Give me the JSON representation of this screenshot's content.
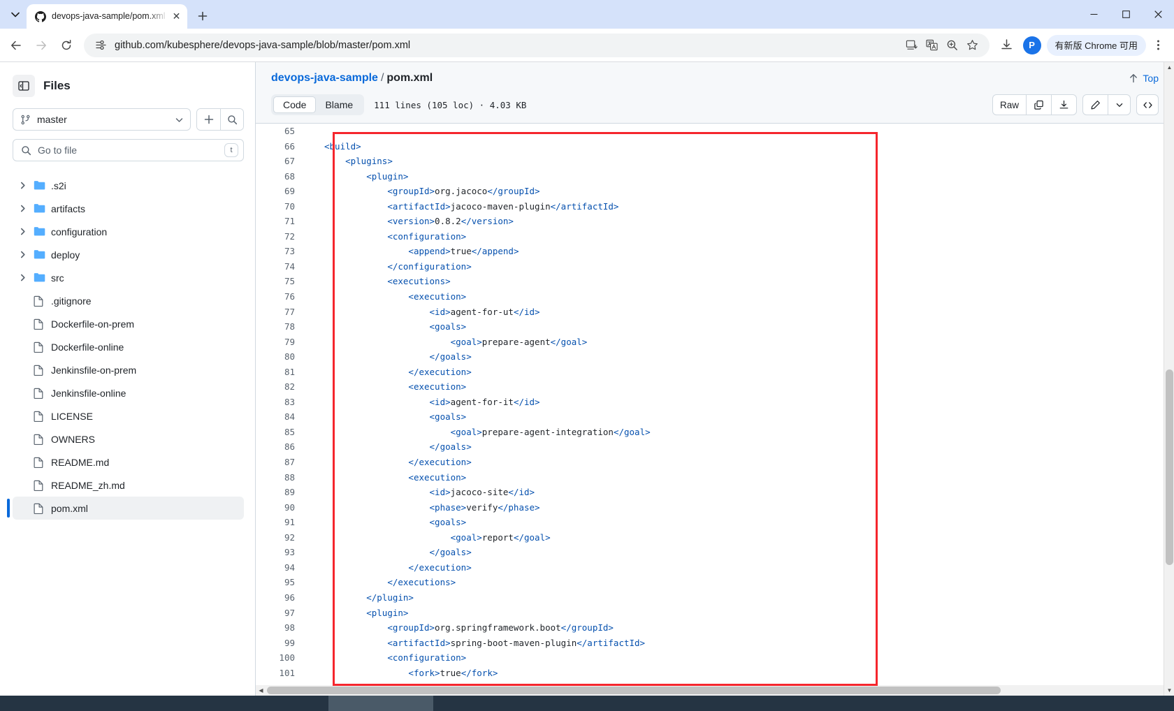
{
  "browser": {
    "tab": {
      "title": "devops-java-sample/pom.xml",
      "favicon_name": "github-icon",
      "close_label": "✕"
    },
    "newtab_label": "+",
    "window_controls": {
      "minimize": "–",
      "maximize": "❐",
      "close": "✕"
    },
    "nav": {
      "back": "←",
      "forward": "→",
      "reload": "⟳"
    },
    "omnibox": {
      "url": "github.com/kubesphere/devops-java-sample/blob/master/pom.xml",
      "site_info_icon": "site-settings-icon",
      "actions": [
        "install-app-icon",
        "translate-icon",
        "zoom-icon",
        "bookmark-star-icon"
      ]
    },
    "downloads_icon": "download-icon",
    "profile_initial": "P",
    "update_button": "有新版 Chrome 可用",
    "menu_icon": "three-dots-vertical-icon"
  },
  "sidebar": {
    "title": "Files",
    "panel_toggle_icon": "collapse-panel-icon",
    "branch": {
      "name": "master",
      "icon": "git-branch-icon",
      "caret": "▾"
    },
    "add_button_icon": "plus-icon",
    "search_button_icon": "search-icon",
    "gotofile": {
      "placeholder": "Go to file",
      "icon": "search-icon",
      "shortcut": "t"
    },
    "tree": [
      {
        "type": "folder",
        "label": ".s2i",
        "expanded": false
      },
      {
        "type": "folder",
        "label": "artifacts",
        "expanded": false
      },
      {
        "type": "folder",
        "label": "configuration",
        "expanded": false
      },
      {
        "type": "folder",
        "label": "deploy",
        "expanded": false
      },
      {
        "type": "folder",
        "label": "src",
        "expanded": false
      },
      {
        "type": "file",
        "label": ".gitignore"
      },
      {
        "type": "file",
        "label": "Dockerfile-on-prem"
      },
      {
        "type": "file",
        "label": "Dockerfile-online"
      },
      {
        "type": "file",
        "label": "Jenkinsfile-on-prem"
      },
      {
        "type": "file",
        "label": "Jenkinsfile-online"
      },
      {
        "type": "file",
        "label": "LICENSE"
      },
      {
        "type": "file",
        "label": "OWNERS"
      },
      {
        "type": "file",
        "label": "README.md"
      },
      {
        "type": "file",
        "label": "README_zh.md"
      },
      {
        "type": "file",
        "label": "pom.xml",
        "selected": true
      }
    ]
  },
  "file_view": {
    "breadcrumb": {
      "repo": "devops-java-sample",
      "separator": "/",
      "file": "pom.xml"
    },
    "top_link": {
      "label": "Top",
      "icon": "arrow-up-icon"
    },
    "tabs": [
      {
        "label": "Code",
        "active": true
      },
      {
        "label": "Blame",
        "active": false
      }
    ],
    "meta": "111 lines (105 loc) · 4.03 KB",
    "actions": {
      "raw": "Raw",
      "copy_icon": "copy-icon",
      "download_icon": "download-icon",
      "edit_icon": "pencil-icon",
      "edit_caret": "▾",
      "symbols_icon": "code-brackets-icon"
    },
    "scroll": {
      "vertical_icon": "scrollbar-thumb",
      "horizontal_icon": "scrollbar-thumb"
    }
  },
  "code": {
    "language": "xml",
    "first_visible_line": 65,
    "lines": [
      {
        "n": 65,
        "tokens": []
      },
      {
        "n": 66,
        "tokens": [
          {
            "t": "tag",
            "v": "<build>"
          }
        ],
        "indent": 0
      },
      {
        "n": 67,
        "tokens": [
          {
            "t": "tag",
            "v": "<plugins>"
          }
        ],
        "indent": 1
      },
      {
        "n": 68,
        "tokens": [
          {
            "t": "tag",
            "v": "<plugin>"
          }
        ],
        "indent": 2
      },
      {
        "n": 69,
        "tokens": [
          {
            "t": "tag",
            "v": "<groupId>"
          },
          {
            "t": "txt",
            "v": "org.jacoco"
          },
          {
            "t": "tag",
            "v": "</groupId>"
          }
        ],
        "indent": 3
      },
      {
        "n": 70,
        "tokens": [
          {
            "t": "tag",
            "v": "<artifactId>"
          },
          {
            "t": "txt",
            "v": "jacoco-maven-plugin"
          },
          {
            "t": "tag",
            "v": "</artifactId>"
          }
        ],
        "indent": 3
      },
      {
        "n": 71,
        "tokens": [
          {
            "t": "tag",
            "v": "<version>"
          },
          {
            "t": "txt",
            "v": "0.8.2"
          },
          {
            "t": "tag",
            "v": "</version>"
          }
        ],
        "indent": 3
      },
      {
        "n": 72,
        "tokens": [
          {
            "t": "tag",
            "v": "<configuration>"
          }
        ],
        "indent": 3
      },
      {
        "n": 73,
        "tokens": [
          {
            "t": "tag",
            "v": "<append>"
          },
          {
            "t": "txt",
            "v": "true"
          },
          {
            "t": "tag",
            "v": "</append>"
          }
        ],
        "indent": 4
      },
      {
        "n": 74,
        "tokens": [
          {
            "t": "tag",
            "v": "</configuration>"
          }
        ],
        "indent": 3
      },
      {
        "n": 75,
        "tokens": [
          {
            "t": "tag",
            "v": "<executions>"
          }
        ],
        "indent": 3
      },
      {
        "n": 76,
        "tokens": [
          {
            "t": "tag",
            "v": "<execution>"
          }
        ],
        "indent": 4
      },
      {
        "n": 77,
        "tokens": [
          {
            "t": "tag",
            "v": "<id>"
          },
          {
            "t": "txt",
            "v": "agent-for-ut"
          },
          {
            "t": "tag",
            "v": "</id>"
          }
        ],
        "indent": 5
      },
      {
        "n": 78,
        "tokens": [
          {
            "t": "tag",
            "v": "<goals>"
          }
        ],
        "indent": 5
      },
      {
        "n": 79,
        "tokens": [
          {
            "t": "tag",
            "v": "<goal>"
          },
          {
            "t": "txt",
            "v": "prepare-agent"
          },
          {
            "t": "tag",
            "v": "</goal>"
          }
        ],
        "indent": 6
      },
      {
        "n": 80,
        "tokens": [
          {
            "t": "tag",
            "v": "</goals>"
          }
        ],
        "indent": 5
      },
      {
        "n": 81,
        "tokens": [
          {
            "t": "tag",
            "v": "</execution>"
          }
        ],
        "indent": 4
      },
      {
        "n": 82,
        "tokens": [
          {
            "t": "tag",
            "v": "<execution>"
          }
        ],
        "indent": 4
      },
      {
        "n": 83,
        "tokens": [
          {
            "t": "tag",
            "v": "<id>"
          },
          {
            "t": "txt",
            "v": "agent-for-it"
          },
          {
            "t": "tag",
            "v": "</id>"
          }
        ],
        "indent": 5
      },
      {
        "n": 84,
        "tokens": [
          {
            "t": "tag",
            "v": "<goals>"
          }
        ],
        "indent": 5
      },
      {
        "n": 85,
        "tokens": [
          {
            "t": "tag",
            "v": "<goal>"
          },
          {
            "t": "txt",
            "v": "prepare-agent-integration"
          },
          {
            "t": "tag",
            "v": "</goal>"
          }
        ],
        "indent": 6
      },
      {
        "n": 86,
        "tokens": [
          {
            "t": "tag",
            "v": "</goals>"
          }
        ],
        "indent": 5
      },
      {
        "n": 87,
        "tokens": [
          {
            "t": "tag",
            "v": "</execution>"
          }
        ],
        "indent": 4
      },
      {
        "n": 88,
        "tokens": [
          {
            "t": "tag",
            "v": "<execution>"
          }
        ],
        "indent": 4
      },
      {
        "n": 89,
        "tokens": [
          {
            "t": "tag",
            "v": "<id>"
          },
          {
            "t": "txt",
            "v": "jacoco-site"
          },
          {
            "t": "tag",
            "v": "</id>"
          }
        ],
        "indent": 5
      },
      {
        "n": 90,
        "tokens": [
          {
            "t": "tag",
            "v": "<phase>"
          },
          {
            "t": "txt",
            "v": "verify"
          },
          {
            "t": "tag",
            "v": "</phase>"
          }
        ],
        "indent": 5
      },
      {
        "n": 91,
        "tokens": [
          {
            "t": "tag",
            "v": "<goals>"
          }
        ],
        "indent": 5
      },
      {
        "n": 92,
        "tokens": [
          {
            "t": "tag",
            "v": "<goal>"
          },
          {
            "t": "txt",
            "v": "report"
          },
          {
            "t": "tag",
            "v": "</goal>"
          }
        ],
        "indent": 6
      },
      {
        "n": 93,
        "tokens": [
          {
            "t": "tag",
            "v": "</goals>"
          }
        ],
        "indent": 5
      },
      {
        "n": 94,
        "tokens": [
          {
            "t": "tag",
            "v": "</execution>"
          }
        ],
        "indent": 4
      },
      {
        "n": 95,
        "tokens": [
          {
            "t": "tag",
            "v": "</executions>"
          }
        ],
        "indent": 3
      },
      {
        "n": 96,
        "tokens": [
          {
            "t": "tag",
            "v": "</plugin>"
          }
        ],
        "indent": 2
      },
      {
        "n": 97,
        "tokens": [
          {
            "t": "tag",
            "v": "<plugin>"
          }
        ],
        "indent": 2
      },
      {
        "n": 98,
        "tokens": [
          {
            "t": "tag",
            "v": "<groupId>"
          },
          {
            "t": "txt",
            "v": "org.springframework.boot"
          },
          {
            "t": "tag",
            "v": "</groupId>"
          }
        ],
        "indent": 3
      },
      {
        "n": 99,
        "tokens": [
          {
            "t": "tag",
            "v": "<artifactId>"
          },
          {
            "t": "txt",
            "v": "spring-boot-maven-plugin"
          },
          {
            "t": "tag",
            "v": "</artifactId>"
          }
        ],
        "indent": 3
      },
      {
        "n": 100,
        "tokens": [
          {
            "t": "tag",
            "v": "<configuration>"
          }
        ],
        "indent": 3
      },
      {
        "n": 101,
        "tokens": [
          {
            "t": "tag",
            "v": "<fork>"
          },
          {
            "t": "txt",
            "v": "true"
          },
          {
            "t": "tag",
            "v": "</fork>"
          }
        ],
        "indent": 4
      }
    ]
  },
  "annotation": {
    "color": "#f5262d",
    "shape": "rectangle"
  },
  "colors": {
    "accent_link": "#0969da",
    "xml_tag": "#0550ae",
    "text": "#1f2328",
    "muted": "#59636e",
    "header_bg": "#f6f8fa",
    "border": "#d1d9e0",
    "chrome_frame": "#d5e2fa"
  },
  "taskbar": {
    "present": true
  }
}
